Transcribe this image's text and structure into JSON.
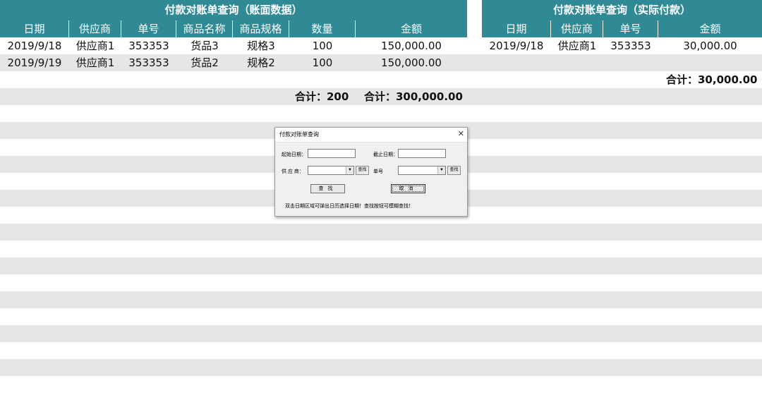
{
  "left_table": {
    "title": "付款对账单查询（账面数据）",
    "columns": [
      "日期",
      "供应商",
      "单号",
      "商品名称",
      "商品规格",
      "数量",
      "金额"
    ],
    "rows": [
      [
        "2019/9/18",
        "供应商1",
        "353353",
        "货品3",
        "规格3",
        "100",
        "150,000.00"
      ],
      [
        "2019/9/19",
        "供应商1",
        "353353",
        "货品2",
        "规格2",
        "100",
        "150,000.00"
      ]
    ],
    "qty_total": "合计：200",
    "amount_total": "合计：300,000.00"
  },
  "right_table": {
    "title": "付款对账单查询（实际付款）",
    "columns": [
      "日期",
      "供应商",
      "单号",
      "金额"
    ],
    "rows": [
      [
        "2019/9/18",
        "供应商1",
        "353353",
        "30,000.00"
      ]
    ],
    "amount_total": "合计：30,000.00"
  },
  "dialog": {
    "title": "付款对账单查询",
    "close_glyph": "✕",
    "start_date_label": "起始日期：",
    "start_date_value": "",
    "end_date_label": "截止日期：",
    "end_date_value": "",
    "supplier_label": "供 应 商：",
    "supplier_value": "",
    "order_label": "单号",
    "order_value": "",
    "find_small_label": "查找",
    "query_button": "查找",
    "cancel_button": "取消",
    "hint": "双击日期区域可弹出日历选择日期！查找按钮可模糊查找！",
    "dropdown_glyph": "▼"
  },
  "colors": {
    "header_bg": "#2f8a96",
    "stripe_gray": "#e6e6e6"
  }
}
